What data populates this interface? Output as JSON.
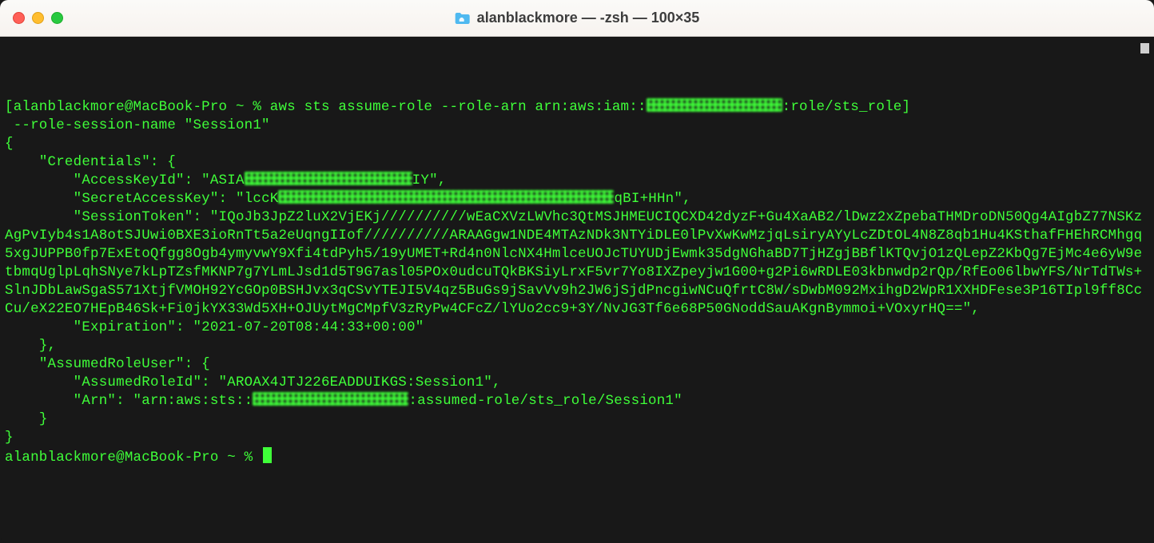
{
  "titlebar": {
    "title": "alanblackmore — -zsh — 100×35"
  },
  "terminal": {
    "prompt_user": "alanblackmore@MacBook-Pro ~ % ",
    "cmd_part1": "aws sts assume-role --role-arn arn:aws:iam::",
    "cmd_part2": ":role/sts_role",
    "cmd_line2": " --role-session-name \"Session1\"",
    "json_open": "{",
    "cred_key": "    \"Credentials\": {",
    "akid_pre": "        \"AccessKeyId\": \"ASIA",
    "akid_post": "IY\",",
    "sak_pre": "        \"SecretAccessKey\": \"lccK",
    "sak_post": "qBI+HHn\",",
    "st_pre": "        \"SessionToken\": \"IQoJb3JpZ2luX2VjEKj//////////wEaCXVzLWVhc3QtMSJHMEUCIQCXD42dyzF+Gu4XaAB2/lDwz2xZpebaTHMDroDN50Qg4AIgbZ77NSKzAgPvIyb4s1A8otSJUwi0BXE3ioRnTt5a2eUqngIIof//////////ARAAGgw1NDE4MTAzNDk3NTYiDLE0lPvXwKwMzjqLsiryAYyLcZDtOL4N8Z8qb1Hu4KSthafFHEhRCMhgq5xgJUPPB0fp7ExEtoQfgg8Ogb4ymyvwY9Xfi4tdPyh5/19yUMET+Rd4n0NlcNX4HmlceUOJcTUYUDjEwmk35dgNGhaBD7TjHZgjBBflKTQvjO1zQLepZ2KbQg7EjMc4e6yW9etbmqUglpLqhSNye7kLpTZsfMKNP7g7YLmLJsd1d5T9G7asl05POx0udcuTQkBKSiyLrxF5vr7Yo8IXZpeyjw1G00+g2Pi6wRDLE03kbnwdp2rQp/RfEo06lbwYFS/NrTdTWs+SlnJDbLawSgaS571XtjfVMOH92YcGOp0BSHJvx3qCSvYTEJI5V4qz5BuGs9jSavVv9h2JW6jSjdPncgiwNCuQfrtC8W/sDwbM092MxihgD2WpR1XXHDFese3P16TIpl9ff8CcCu/eX22EO7HEpB46Sk+Fi0jkYX33Wd5XH+OJUytMgCMpfV3zRyPw4CFcZ/lYUo2cc9+3Y/NvJG3Tf6e68P50GNoddSauAKgnBymmoi+VOxyrHQ==\",",
    "exp": "        \"Expiration\": \"2021-07-20T08:44:33+00:00\"",
    "cred_close": "    },",
    "aru_key": "    \"AssumedRoleUser\": {",
    "arid": "        \"AssumedRoleId\": \"AROAX4JTJ226EADDUIKGS:Session1\",",
    "arn_pre": "        \"Arn\": \"arn:aws:sts::",
    "arn_post": ":assumed-role/sts_role/Session1\"",
    "aru_close": "    }",
    "json_close": "}",
    "prompt2": "alanblackmore@MacBook-Pro ~ % "
  },
  "colors": {
    "terminal_bg": "#181818",
    "text_green": "#3fff39",
    "titlebar_bg": "#f7f3ef"
  }
}
